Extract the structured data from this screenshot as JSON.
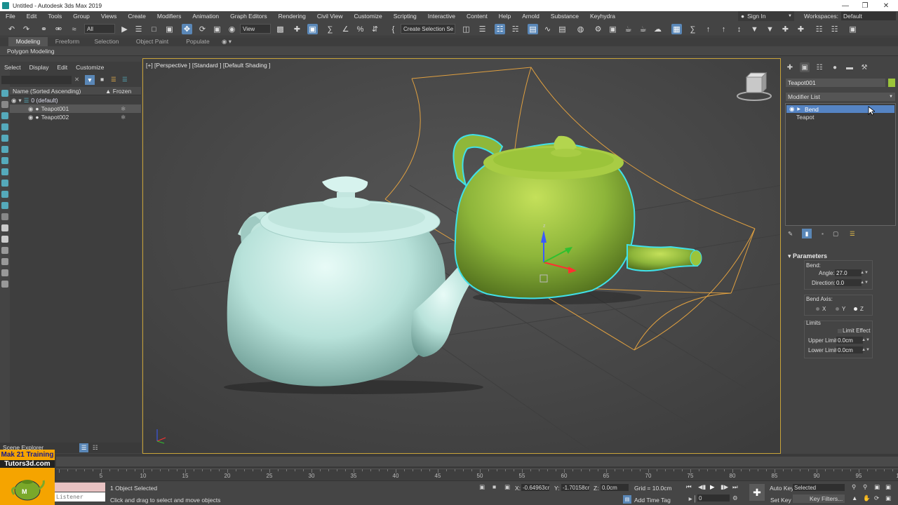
{
  "window": {
    "title": "Untitled - Autodesk 3ds Max 2019"
  },
  "menu": {
    "items": [
      "File",
      "Edit",
      "Tools",
      "Group",
      "Views",
      "Create",
      "Modifiers",
      "Animation",
      "Graph Editors",
      "Rendering",
      "Civil View",
      "Customize",
      "Scripting",
      "Interactive",
      "Content",
      "Help",
      "Arnold",
      "Substance",
      "Keyhydra"
    ],
    "sign_in": "Sign In",
    "workspace_label": "Workspaces:",
    "workspace_value": "Default"
  },
  "toolbar": {
    "filter_value": "All",
    "view_value": "View",
    "selection_set_placeholder": "Create Selection Se"
  },
  "ribbon": {
    "tabs": [
      "Modeling",
      "Freeform",
      "Selection",
      "Object Paint",
      "Populate"
    ],
    "sub_label": "Polygon Modeling"
  },
  "scene_explorer": {
    "menu": [
      "Select",
      "Display",
      "Edit",
      "Customize"
    ],
    "col_name": "Name (Sorted Ascending)",
    "col_frozen": "▲ Frozen",
    "rows": [
      {
        "name": "0 (default)"
      },
      {
        "name": "Teapot001"
      },
      {
        "name": "Teapot002"
      }
    ],
    "footer_label": "Scene Explorer"
  },
  "viewport": {
    "label": "[+] [Perspective ] [Standard ] [Default Shading ]"
  },
  "command_panel": {
    "object_name": "Teapot001",
    "object_color": "#9bc43a",
    "modifier_list_label": "Modifier List",
    "stack": [
      {
        "name": "Bend"
      },
      {
        "name": "Teapot"
      }
    ],
    "params": {
      "title": "Parameters",
      "bend_label": "Bend:",
      "angle_label": "Angle:",
      "angle_value": "27.0",
      "direction_label": "Direction:",
      "direction_value": "0.0",
      "bend_axis_label": "Bend Axis:",
      "axis_x": "X",
      "axis_y": "Y",
      "axis_z": "Z",
      "selected_axis": "Z",
      "limits_label": "Limits",
      "limit_effect_label": "Limit Effect",
      "upper_limit_label": "Upper Limit:",
      "upper_limit_value": "0.0cm",
      "lower_limit_label": "Lower Limit:",
      "lower_limit_value": "0.0cm"
    }
  },
  "timeline": {
    "ticks": [
      "5",
      "10",
      "15",
      "20",
      "25",
      "30",
      "35",
      "40",
      "45",
      "50",
      "55",
      "60",
      "65",
      "70",
      "75",
      "80",
      "85",
      "90",
      "95",
      "100"
    ]
  },
  "status": {
    "selected_text": "1 Object Selected",
    "prompt_text": "Click and drag to select and move objects",
    "listener_text": "Listener",
    "x_label": "X:",
    "x_value": "-0.64963cr",
    "y_label": "Y:",
    "y_value": "-1.70158cr",
    "z_label": "Z:",
    "z_value": "0.0cm",
    "grid_text": "Grid = 10.0cm",
    "add_time_tag": "Add Time Tag",
    "frame_value": "0",
    "auto_key": "Auto Key",
    "selected_dropdown": "Selected",
    "set_key": "Set Key",
    "key_filters": "Key Filters..."
  },
  "watermark": {
    "line1": "Mak 21 Training",
    "line2": "Tutors3d.com"
  }
}
